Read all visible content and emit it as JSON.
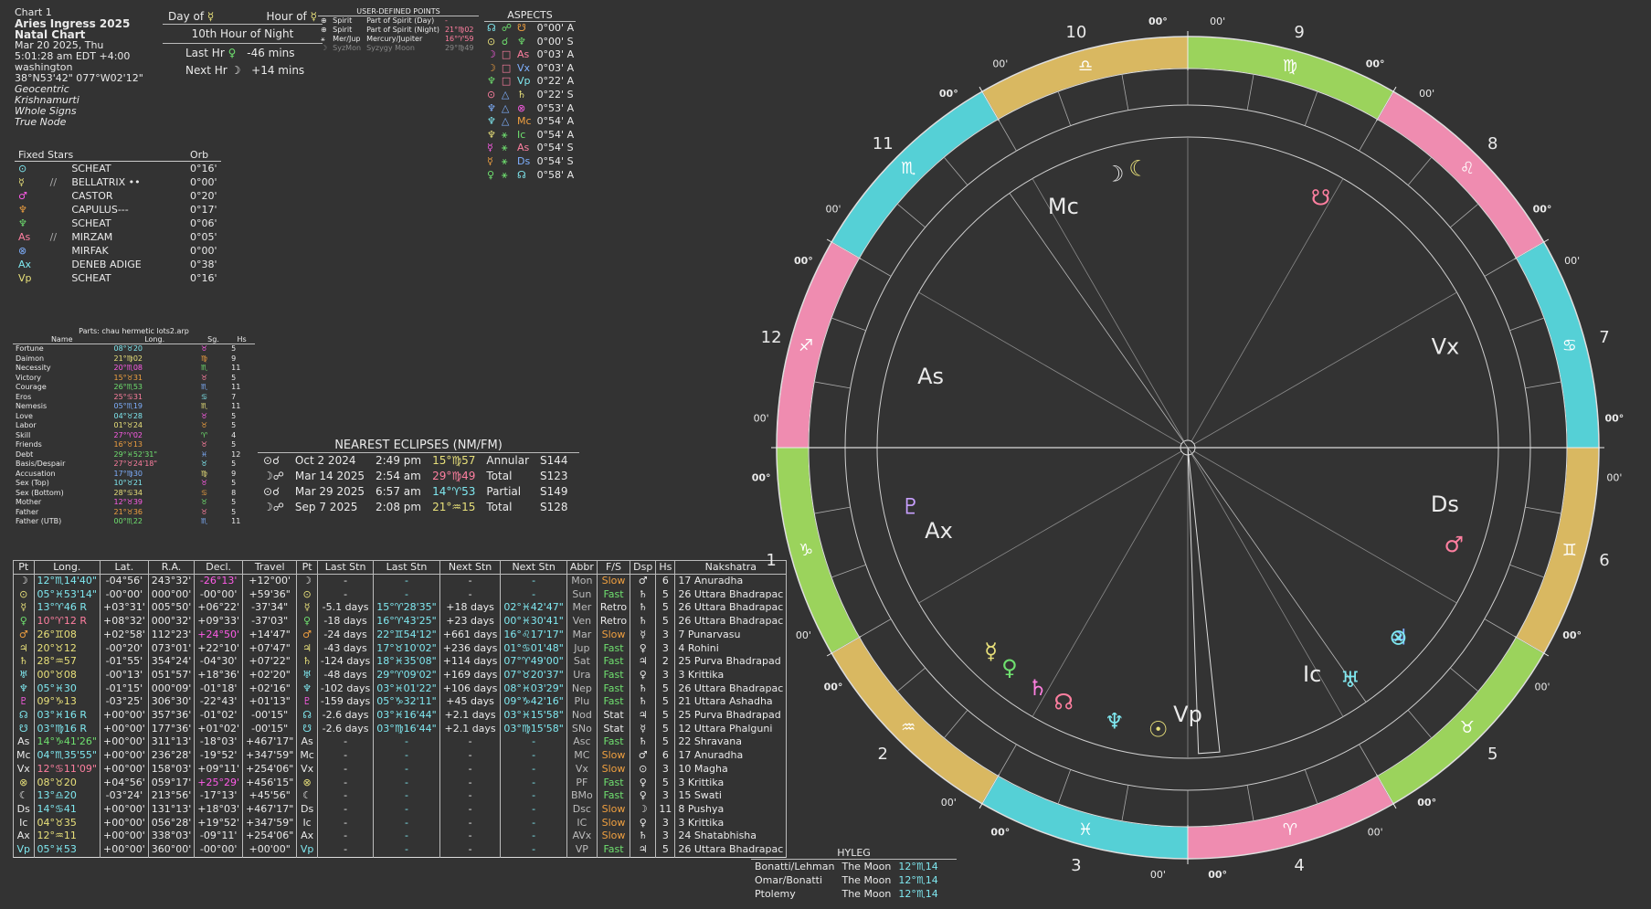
{
  "header": {
    "chart_no": "Chart 1",
    "title": "Aries Ingress 2025",
    "type": "Natal Chart",
    "date": "Mar 20 2025, Thu",
    "time": "5:01:28 am  EDT +4:00",
    "place": "washington",
    "coords": "38°N53'42\" 077°W02'12\"",
    "opt1": "Geocentric",
    "opt2": "Krishnamurti",
    "opt3": "Whole Signs",
    "opt4": "True Node"
  },
  "hours": {
    "day_of": "Day of",
    "hour_of": "Hour of",
    "day_sym": "☿",
    "hour_sym": "☿",
    "tenth": "10th Hour of Night",
    "last_lbl": "Last Hr",
    "last_sym": "♀",
    "last_val": "-46 mins",
    "next_lbl": "Next Hr",
    "next_sym": "☽",
    "next_val": "+14 mins"
  },
  "udp": {
    "title": "USER-DEFINED POINTS",
    "rows": [
      [
        "⊕",
        "Spirit",
        "Part of Spirit (Day)",
        "-"
      ],
      [
        "⊕",
        "Spirit",
        "Part of Spirit (Night)",
        "21°♍02"
      ],
      [
        "⚹",
        "Mer/Jup",
        "Mercury/Jupiter",
        "16°♈59"
      ],
      [
        "☽",
        "SyzMon",
        "Syzygy Moon",
        "29°♍49"
      ]
    ]
  },
  "aspects": {
    "title": "ASPECTS",
    "rows": [
      [
        "☊",
        "☍",
        "☋",
        "0°00' A"
      ],
      [
        "⊙",
        "☌",
        "♆",
        "0°00' S"
      ],
      [
        "☽",
        "□",
        "As",
        "0°03' A"
      ],
      [
        "☽",
        "□",
        "Vx",
        "0°03' A"
      ],
      [
        "♆",
        "□",
        "Vp",
        "0°22' A"
      ],
      [
        "⊙",
        "△",
        "♄",
        "0°22' S"
      ],
      [
        "♆",
        "△",
        "⊗",
        "0°53' A"
      ],
      [
        "♆",
        "△",
        "Mc",
        "0°54' A"
      ],
      [
        "♆",
        "⚹",
        "Ic",
        "0°54' A"
      ],
      [
        "☿",
        "⚹",
        "As",
        "0°54' S"
      ],
      [
        "☿",
        "⚹",
        "Ds",
        "0°54' S"
      ],
      [
        "♀",
        "⚹",
        "☊",
        "0°58' A"
      ]
    ]
  },
  "fixed_stars": {
    "h1": "Fixed Stars",
    "h2": "Orb",
    "rows": [
      [
        "⊙",
        "",
        "SCHEAT",
        "0°16'"
      ],
      [
        "☿",
        "//",
        "BELLATRIX ••",
        "0°00'"
      ],
      [
        "♂",
        "",
        "CASTOR",
        "0°20'"
      ],
      [
        "♆",
        "",
        "CAPULUS---",
        "0°17'"
      ],
      [
        "♆",
        "",
        "SCHEAT",
        "0°06'"
      ],
      [
        "As",
        "//",
        "MIRZAM",
        "0°05'"
      ],
      [
        "⊗",
        "",
        "MIRFAK",
        "0°00'"
      ],
      [
        "Ax",
        "",
        "DENEB ADIGE",
        "0°38'"
      ],
      [
        "Vp",
        "",
        "SCHEAT",
        "0°16'"
      ]
    ]
  },
  "parts": {
    "title": "Parts: chau hermetic lots2.arp",
    "h": [
      "Name",
      "Long.",
      "Sg.",
      "Hs"
    ],
    "rows": [
      [
        "Fortune",
        "08°♉20",
        "♉",
        "5"
      ],
      [
        "Daimon",
        "21°♍02",
        "♍",
        "9"
      ],
      [
        "Necessity",
        "20°♏08",
        "♏",
        "11"
      ],
      [
        "Victory",
        "15°♉31",
        "♉",
        "5"
      ],
      [
        "Courage",
        "26°♏53",
        "♏",
        "11"
      ],
      [
        "Eros",
        "25°♋31",
        "♋",
        "7"
      ],
      [
        "Nemesis",
        "05°♏19",
        "♏",
        "11"
      ],
      [
        "Love",
        "04°♉28",
        "♉",
        "5"
      ],
      [
        "Labor",
        "01°♉24",
        "♉",
        "5"
      ],
      [
        "Skill",
        "27°♈02",
        "♈",
        "4"
      ],
      [
        "Friends",
        "16°♉13",
        "♉",
        "5"
      ],
      [
        "Debt",
        "29°♓52'31\"",
        "♓",
        "12"
      ],
      [
        "Basis/Despair",
        "27°♉24'18\"",
        "♉",
        "5"
      ],
      [
        "Accusation",
        "17°♍30",
        "♍",
        "9"
      ],
      [
        "Sex (Top)",
        "10°♉21",
        "♉",
        "5"
      ],
      [
        "Sex (Bottom)",
        "28°♋34",
        "♋",
        "8"
      ],
      [
        "Mother",
        "12°♉39",
        "♉",
        "5"
      ],
      [
        "Father",
        "21°♉36",
        "♉",
        "5"
      ],
      [
        "Father (UTB)",
        "00°♏22",
        "♏",
        "11"
      ]
    ]
  },
  "eclipses": {
    "title": "NEAREST ECLIPSES (NM/FM)",
    "rows": [
      [
        "⊙☌",
        "Oct 2 2024",
        "2:49 pm",
        "15°♍57",
        "Annular",
        "S144"
      ],
      [
        "☽☍",
        "Mar 14 2025",
        "2:54 am",
        "29°♍49",
        "Total",
        "S123"
      ],
      [
        "⊙☌",
        "Mar 29 2025",
        "6:57 am",
        "14°♈53",
        "Partial",
        "S149"
      ],
      [
        "☽☍",
        "Sep 7 2025",
        "2:08 pm",
        "21°♒15",
        "Total",
        "S128"
      ]
    ]
  },
  "planets": {
    "headers": [
      "Pt",
      "Long.",
      "Lat.",
      "R.A.",
      "Decl.",
      "Travel",
      "Pt",
      "Last Stn",
      "Last Stn",
      "Next Stn",
      "Next Stn",
      "Abbr",
      "F/S",
      "Dsp",
      "Hs",
      "Nakshatra"
    ],
    "rows": [
      [
        "☽",
        "12°♏14'40\"",
        "-04°56'",
        "243°32'",
        "-26°13'",
        "+12°00'",
        "☽",
        "-",
        "-",
        "-",
        "-",
        "Mon",
        "Slow",
        "♂",
        "6",
        "17 Anuradha"
      ],
      [
        "⊙",
        "05°♓53'14\"",
        "-00°00'",
        "000°00'",
        "-00°00'",
        "+59'36\"",
        "⊙",
        "-",
        "-",
        "-",
        "-",
        "Sun",
        "Fast",
        "♄",
        "5",
        "26 Uttara Bhadrapac"
      ],
      [
        "☿",
        "13°♈46 R",
        "+03°31'",
        "005°50'",
        "+06°22'",
        "-37'34\"",
        "☿",
        "-5.1 days",
        "15°♈28'35\"",
        "+18 days",
        "02°♓42'47\"",
        "Mer",
        "Retro",
        "♄",
        "5",
        "26 Uttara Bhadrapac"
      ],
      [
        "♀",
        "10°♈12 R",
        "+08°32'",
        "000°32'",
        "+09°33'",
        "-37'03\"",
        "♀",
        "-18 days",
        "16°♈43'25\"",
        "+23 days",
        "00°♓30'41\"",
        "Ven",
        "Retro",
        "♄",
        "5",
        "26 Uttara Bhadrapac"
      ],
      [
        "♂",
        "26°♊08",
        "+02°58'",
        "112°23'",
        "+24°50'",
        "+14'47\"",
        "♂",
        "-24 days",
        "22°♊54'12\"",
        "+661 days",
        "16°♌17'17\"",
        "Mar",
        "Slow",
        "☿",
        "3",
        "7 Punarvasu"
      ],
      [
        "♃",
        "20°♉12",
        "-00°20'",
        "073°01'",
        "+22°10'",
        "+07'47\"",
        "♃",
        "-43 days",
        "17°♉10'02\"",
        "+236 days",
        "01°♋01'48\"",
        "Jup",
        "Fast",
        "♀",
        "3",
        "4 Rohini"
      ],
      [
        "♄",
        "28°♒57",
        "-01°55'",
        "354°24'",
        "-04°30'",
        "+07'22\"",
        "♄",
        "-124 days",
        "18°♓35'08\"",
        "+114 days",
        "07°♈49'00\"",
        "Sat",
        "Fast",
        "♃",
        "2",
        "25 Purva Bhadrapad"
      ],
      [
        "♅",
        "00°♉08",
        "-00°13'",
        "051°57'",
        "+18°36'",
        "+02'20\"",
        "♅",
        "-48 days",
        "29°♈09'02\"",
        "+169 days",
        "07°♉20'37\"",
        "Ura",
        "Fast",
        "♀",
        "3",
        "3 Krittika"
      ],
      [
        "♆",
        "05°♓30",
        "-01°15'",
        "000°09'",
        "-01°18'",
        "+02'16\"",
        "♆",
        "-102 days",
        "03°♓01'22\"",
        "+106 days",
        "08°♓03'29\"",
        "Nep",
        "Fast",
        "♄",
        "5",
        "26 Uttara Bhadrapac"
      ],
      [
        "♇",
        "09°♑13",
        "-03°25'",
        "306°30'",
        "-22°43'",
        "+01'13\"",
        "♇",
        "-159 days",
        "05°♑32'11\"",
        "+45 days",
        "09°♑42'16\"",
        "Plu",
        "Fast",
        "♄",
        "5",
        "21 Uttara Ashadha"
      ],
      [
        "☊",
        "03°♓16 R",
        "+00°00'",
        "357°36'",
        "-01°02'",
        "-00'15\"",
        "☊",
        "-2.6 days",
        "03°♓16'44\"",
        "+2.1 days",
        "03°♓15'58\"",
        "Nod",
        "Stat",
        "♃",
        "5",
        "25 Purva Bhadrapad"
      ],
      [
        "☋",
        "03°♍16 R",
        "+00°00'",
        "177°36'",
        "+01°02'",
        "-00'15\"",
        "☋",
        "-2.6 days",
        "03°♍16'44\"",
        "+2.1 days",
        "03°♍15'58\"",
        "SNo",
        "Stat",
        "☿",
        "5",
        "12 Uttara Phalguni"
      ],
      [
        "As",
        "14°♑41'26\"",
        "+00°00'",
        "311°13'",
        "-18°03'",
        "+467'17\"",
        "As",
        "-",
        "-",
        "-",
        "-",
        "Asc",
        "Fast",
        "♄",
        "5",
        "22 Shravana"
      ],
      [
        "Mc",
        "04°♏35'55\"",
        "+00°00'",
        "236°28'",
        "-19°52'",
        "+347'59\"",
        "Mc",
        "-",
        "-",
        "-",
        "-",
        "MC",
        "Slow",
        "♂",
        "6",
        "17 Anuradha"
      ],
      [
        "Vx",
        "12°♋11'09\"",
        "+00°00'",
        "158°03'",
        "+09°11'",
        "+254'06\"",
        "Vx",
        "-",
        "-",
        "-",
        "-",
        "Vx",
        "Slow",
        "⊙",
        "3",
        "10 Magha"
      ],
      [
        "⊗",
        "08°♉20",
        "+04°56'",
        "059°17'",
        "+25°29'",
        "+456'15\"",
        "⊗",
        "-",
        "-",
        "-",
        "-",
        "PF",
        "Fast",
        "♀",
        "5",
        "3 Krittika"
      ],
      [
        "☾",
        "13°♎20",
        "-03°24'",
        "213°56'",
        "-17°13'",
        "+45'56\"",
        "☾",
        "-",
        "-",
        "-",
        "-",
        "BMo",
        "Fast",
        "♀",
        "3",
        "15 Swati"
      ],
      [
        "Ds",
        "14°♋41",
        "+00°00'",
        "131°13'",
        "+18°03'",
        "+467'17\"",
        "Ds",
        "-",
        "-",
        "-",
        "-",
        "Dsc",
        "Slow",
        "☽",
        "11",
        "8 Pushya"
      ],
      [
        "Ic",
        "04°♉35",
        "+00°00'",
        "056°28'",
        "+19°52'",
        "+347'59\"",
        "Ic",
        "-",
        "-",
        "-",
        "-",
        "IC",
        "Slow",
        "♀",
        "3",
        "3 Krittika"
      ],
      [
        "Ax",
        "12°♒11",
        "+00°00'",
        "338°03'",
        "-09°11'",
        "+254'06\"",
        "Ax",
        "-",
        "-",
        "-",
        "-",
        "AVx",
        "Slow",
        "♄",
        "3",
        "24 Shatabhisha"
      ],
      [
        "Vp",
        "05°♓53",
        "+00°00'",
        "360°00'",
        "-00°00'",
        "+00'00\"",
        "Vp",
        "-",
        "-",
        "-",
        "-",
        "VP",
        "Fast",
        "♃",
        "5",
        "26 Uttara Bhadrapac"
      ]
    ]
  },
  "hyleg": {
    "title": "HYLEG",
    "rows": [
      [
        "Bonatti/Lehman",
        "The Moon",
        "12°♏14"
      ],
      [
        "Omar/Bonatti",
        "The Moon",
        "12°♏14"
      ],
      [
        "Ptolemy",
        "The Moon",
        "12°♏14"
      ]
    ]
  },
  "wheel": {
    "house_numbers": [
      "1",
      "2",
      "3",
      "4",
      "5",
      "6",
      "7",
      "8",
      "9",
      "10",
      "11",
      "12"
    ],
    "cusp_deg_label": "00°",
    "cusp_min_label": "00'",
    "sign_glyphs": [
      "♑",
      "♒",
      "♓",
      "♈",
      "♉",
      "♊",
      "♋",
      "♌",
      "♍",
      "♎",
      "♏",
      "♐"
    ],
    "points": [
      {
        "g": "As",
        "label": "As"
      },
      {
        "g": "Mc",
        "label": "Mc"
      },
      {
        "g": "Ds",
        "label": "Ds"
      },
      {
        "g": "Ic",
        "label": "Ic"
      },
      {
        "g": "Vx",
        "label": "Vx"
      },
      {
        "g": "Ax",
        "label": "Ax"
      },
      {
        "g": "Vp",
        "label": "Vp"
      }
    ],
    "planet_glyphs": [
      "☽",
      "☉",
      "☿",
      "♀",
      "♂",
      "♃",
      "♄",
      "♅",
      "♆",
      "♇",
      "☊",
      "☋",
      "⊗",
      "☾"
    ],
    "colors": {
      "capricorn": "#9bd35c",
      "aquarius": "#d9b861",
      "pisces": "#55d0d6",
      "aries": "#ef8cb0"
    }
  }
}
